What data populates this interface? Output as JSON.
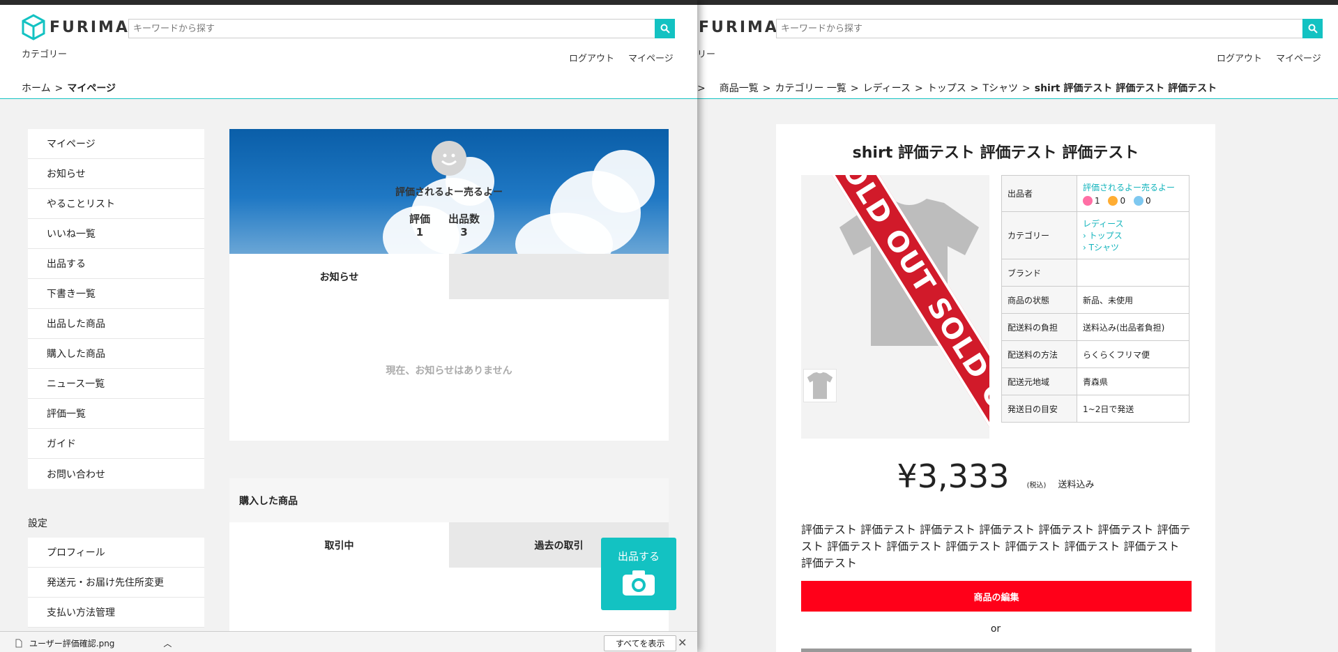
{
  "left": {
    "logo_text": "FURIMA",
    "search_placeholder": "キーワードから探す",
    "category_label": "カテゴリー",
    "logout": "ログアウト",
    "mypage": "マイページ",
    "breadcrumb": {
      "home": "ホーム",
      "sep": ">",
      "current": "マイページ"
    },
    "sidebar_items": [
      "マイページ",
      "お知らせ",
      "やることリスト",
      "いいね一覧",
      "出品する",
      "下書き一覧",
      "出品した商品",
      "購入した商品",
      "ニュース一覧",
      "評価一覧",
      "ガイド",
      "お問い合わせ"
    ],
    "settings_label": "設定",
    "settings_items": [
      "プロフィール",
      "発送元・お届け先住所変更",
      "支払い方法管理"
    ],
    "profile": {
      "name": "評価されるよー売るよー",
      "rating_label": "評価",
      "rating_value": "1",
      "listings_label": "出品数",
      "listings_value": "3"
    },
    "tabs": {
      "notice": "お知らせ"
    },
    "notice_empty": "現在、お知らせはありません",
    "purchased_title": "購入した商品",
    "purchased_tabs": [
      "取引中",
      "過去の取引"
    ],
    "sell_button": "出品する",
    "download": {
      "filename": "ユーザー評価確認.png",
      "show_all": "すべてを表示",
      "close": "✕"
    }
  },
  "right": {
    "logo_text": "FURIMA",
    "search_placeholder": "キーワードから探す",
    "category_label": "リー",
    "logout": "ログアウト",
    "mypage": "マイページ",
    "breadcrumb": [
      "商品一覧",
      "カテゴリー 一覧",
      "レディース",
      "トップス",
      "Tシャツ"
    ],
    "breadcrumb_current": "shirt 評価テスト 評価テスト 評価テスト",
    "product": {
      "title": "shirt 評価テスト 評価テスト 評価テスト",
      "sold_text": "SOLD OUT SOLD OUT",
      "seller_label": "出品者",
      "seller_name": "評価されるよー売るよー",
      "good": "1",
      "normal": "0",
      "bad": "0",
      "category_label": "カテゴリー",
      "cat1": "レディース",
      "cat2": "トップス",
      "cat3": "Tシャツ",
      "brand_label": "ブランド",
      "brand_value": "",
      "condition_label": "商品の状態",
      "condition_value": "新品、未使用",
      "fee_label": "配送料の負担",
      "fee_value": "送料込み(出品者負担)",
      "method_label": "配送料の方法",
      "method_value": "らくらくフリマ便",
      "region_label": "配送元地域",
      "region_value": "青森県",
      "days_label": "発送日の目安",
      "days_value": "1~2日で発送",
      "price": "¥3,333",
      "tax": "(税込)",
      "shipping": "送料込み",
      "description": "評価テスト 評価テスト 評価テスト 評価テスト 評価テスト 評価テスト 評価テスト 評価テスト 評価テスト 評価テスト 評価テスト 評価テスト 評価テスト 評価テスト",
      "edit_button": "商品の編集",
      "or": "or"
    }
  },
  "colors": {
    "accent": "#13c2c2",
    "danger": "#ff0019",
    "sold": "#d11a2a"
  },
  "icons": [
    "logo-cube-icon",
    "search-icon",
    "smile-avatar-icon",
    "camera-icon",
    "file-icon",
    "chevron-up-icon",
    "close-icon",
    "smile-emoji-icon",
    "neutral-emoji-icon",
    "sad-emoji-icon"
  ]
}
